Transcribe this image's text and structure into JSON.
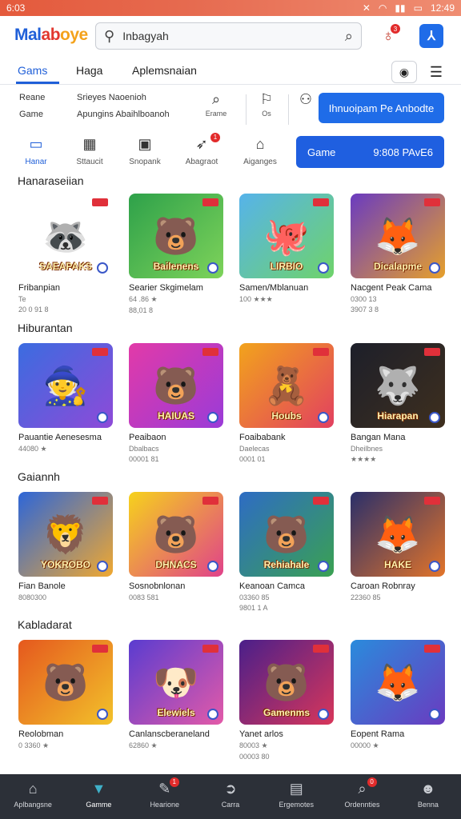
{
  "status_bar": {
    "time": "6:03",
    "right": "12:49"
  },
  "header": {
    "logo": [
      "Mal",
      "ab",
      "oye"
    ],
    "search_value": "Inbagyah",
    "notif_count": "3"
  },
  "tabs": {
    "items": [
      "Gams",
      "Haga",
      "Aplemsnaian"
    ]
  },
  "info": {
    "col1": [
      "Reane",
      "Game"
    ],
    "col2": [
      "Srieyes Naoenioh",
      "Apungins Abaihlboanoh"
    ],
    "btn1_label": "Erame",
    "btn2_label": "Os",
    "action": "Ihnuoipam Pe Anbodte"
  },
  "categories": {
    "items": [
      "Hanar",
      "Sttaucit",
      "Snopank",
      "Abagraot",
      "Aiganges"
    ],
    "badge": "1",
    "banner_left": "Game",
    "banner_right": "9:808  PAvE6"
  },
  "sections": [
    {
      "title": "Hanaraseiian",
      "cards": [
        {
          "thumb_title": "SAEAPAKS",
          "name": "Fribanpian",
          "meta1": "Te",
          "meta2": "20 0 91 8",
          "colors": [
            "#ffffff",
            "#ffffff"
          ],
          "mascot": "🦝"
        },
        {
          "thumb_title": "Bailenens",
          "name": "Searier Skgimelam",
          "meta1": "64 .86 ★",
          "meta2": "88,01 8",
          "colors": [
            "#2ea14a",
            "#7ed35a"
          ],
          "mascot": "🐻"
        },
        {
          "thumb_title": "LIRBIO",
          "name": "Samen/Mblanuan",
          "meta1": "100 ★★★",
          "meta2": "",
          "colors": [
            "#56b3ea",
            "#6fd36a"
          ],
          "mascot": "🐙"
        },
        {
          "thumb_title": "Dicalapme",
          "name": "Nacgent Peak Cama",
          "meta1": "0300 13",
          "meta2": "3907 3 8",
          "colors": [
            "#6a3bc0",
            "#e6a02b"
          ],
          "mascot": "🦊"
        }
      ]
    },
    {
      "title": "Hiburantan",
      "cards": [
        {
          "thumb_title": "",
          "name": "Pauantie Aenesesma",
          "meta1": "44080 ★",
          "meta2": "",
          "colors": [
            "#3b6ce0",
            "#8e4ad8"
          ],
          "mascot": "🧙"
        },
        {
          "thumb_title": "HAIUAS",
          "name": "Peaibaon",
          "meta1": "Dbalbacs",
          "meta2": "00001 81",
          "colors": [
            "#e23aa8",
            "#9a3bd8"
          ],
          "mascot": "🐻"
        },
        {
          "thumb_title": "Houbs",
          "name": "Foaibabank",
          "meta1": "Daelecas",
          "meta2": "0001 01 ",
          "colors": [
            "#f2a31c",
            "#e24060"
          ],
          "mascot": "🧸"
        },
        {
          "thumb_title": "Hiarapan",
          "name": "Bangan Mana",
          "meta1": "Dheilbnes",
          "meta2": "★★★★",
          "colors": [
            "#1d1f2a",
            "#3e2f1e"
          ],
          "mascot": "🐺"
        }
      ]
    },
    {
      "title": "Gaiannh",
      "cards": [
        {
          "thumb_title": "YOKROBO",
          "name": "Fian Banole",
          "meta1": "8080300",
          "meta2": "",
          "colors": [
            "#2d66d8",
            "#f0a830"
          ],
          "mascot": "🦁"
        },
        {
          "thumb_title": "DHNACS",
          "name": "Sosnobnlonan",
          "meta1": "0083 581",
          "meta2": "",
          "colors": [
            "#f6d21c",
            "#e0428a"
          ],
          "mascot": "🐻"
        },
        {
          "thumb_title": "Rehiahale",
          "name": "Keanoan Camca",
          "meta1": "03360 85",
          "meta2": "9801 1 A",
          "colors": [
            "#2e6cc4",
            "#3aa152"
          ],
          "mascot": "🐻"
        },
        {
          "thumb_title": "HAKE",
          "name": "Caroan Robnray",
          "meta1": "22360 85",
          "meta2": "",
          "colors": [
            "#2a2f6a",
            "#e2742a"
          ],
          "mascot": "🦊"
        }
      ]
    },
    {
      "title": "Kabladarat",
      "cards": [
        {
          "thumb_title": "",
          "name": "Reolobman",
          "meta1": "0 3360 ★",
          "meta2": "",
          "colors": [
            "#e5581e",
            "#f2c22a"
          ],
          "mascot": "🐻"
        },
        {
          "thumb_title": "Elewiels",
          "name": "Canlanscberaneland",
          "meta1": "62860 ★",
          "meta2": "",
          "colors": [
            "#5a3cd0",
            "#e35aa8"
          ],
          "mascot": "🐶"
        },
        {
          "thumb_title": "Gamenms",
          "name": "Yanet arlos",
          "meta1": "80003 ★",
          "meta2": "00003 80",
          "colors": [
            "#4a1f8a",
            "#d8365a"
          ],
          "mascot": "🐻"
        },
        {
          "thumb_title": "",
          "name": "Eopent Rama",
          "meta1": "00000 ★",
          "meta2": "",
          "colors": [
            "#2a8bdc",
            "#6a3bc0"
          ],
          "mascot": "🦊"
        }
      ]
    }
  ],
  "bottom_nav": {
    "items": [
      "Aplbangsne",
      "Gamme",
      "Hearione",
      "Carra",
      "Ergemotes",
      "Ordennties",
      "Benna"
    ],
    "badge1": "1",
    "badge2": "0"
  }
}
